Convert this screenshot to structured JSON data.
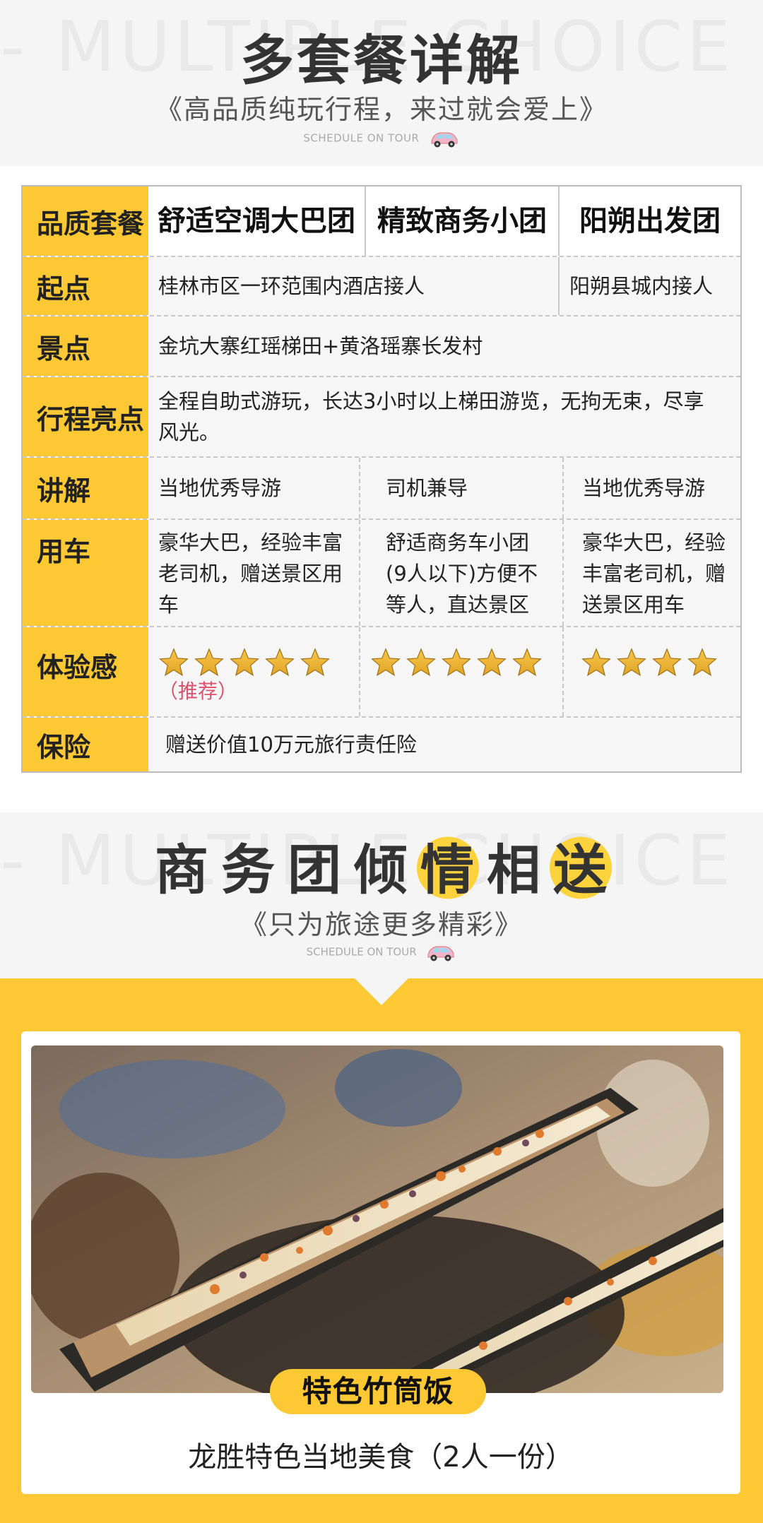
{
  "header1": {
    "watermark": "- MULTIPLE CHOICE -",
    "title": "多套餐详解",
    "subtitle": "《高品质纯玩行程，来过就会爱上》",
    "tag": "SCHEDULE ON TOUR"
  },
  "table": {
    "corner": "品质套餐",
    "packages": [
      "舒适空调大巴团",
      "精致商务小团",
      "阳朔出发团"
    ],
    "rows": {
      "pickup": {
        "label": "起点",
        "cells": [
          "桂林市区一环范围内酒店接人",
          "阳朔县城内接人"
        ]
      },
      "spots": {
        "label": "景点",
        "cells": [
          "金坑大寨红瑶梯田+黄洛瑶寨长发村"
        ]
      },
      "highlights": {
        "label": "行程亮点",
        "cells": [
          "全程自助式游玩，长达3小时以上梯田游览，无拘无束，尽享风光。"
        ]
      },
      "guide": {
        "label": "讲解",
        "cells": [
          "当地优秀导游",
          "司机兼导",
          "当地优秀导游"
        ]
      },
      "vehicle": {
        "label": "用车",
        "cells": [
          "豪华大巴，经验丰富老司机，赠送景区用车",
          "舒适商务车小团(9人以下)方便不等人，直达景区",
          "豪华大巴，经验丰富老司机，赠送景区用车"
        ]
      },
      "experience": {
        "label": "体验感",
        "stars": [
          5,
          5,
          4
        ],
        "recommend": "（推荐）"
      },
      "insurance": {
        "label": "保险",
        "cells": [
          "赠送价值10万元旅行责任险"
        ]
      }
    }
  },
  "header2": {
    "watermark": "- MULTIPLE CHOICE -",
    "title_chars": [
      "商",
      "务",
      "团",
      "倾",
      "情",
      "相",
      "送"
    ],
    "subtitle": "《只为旅途更多精彩》",
    "tag": "SCHEDULE ON TOUR"
  },
  "food": {
    "label": "特色竹筒饭",
    "description": "龙胜特色当地美食（2人一份）"
  },
  "colors": {
    "accent_yellow": "#fcc934",
    "recommend_pink": "#d9536f",
    "star_gold": "#e0a526"
  }
}
